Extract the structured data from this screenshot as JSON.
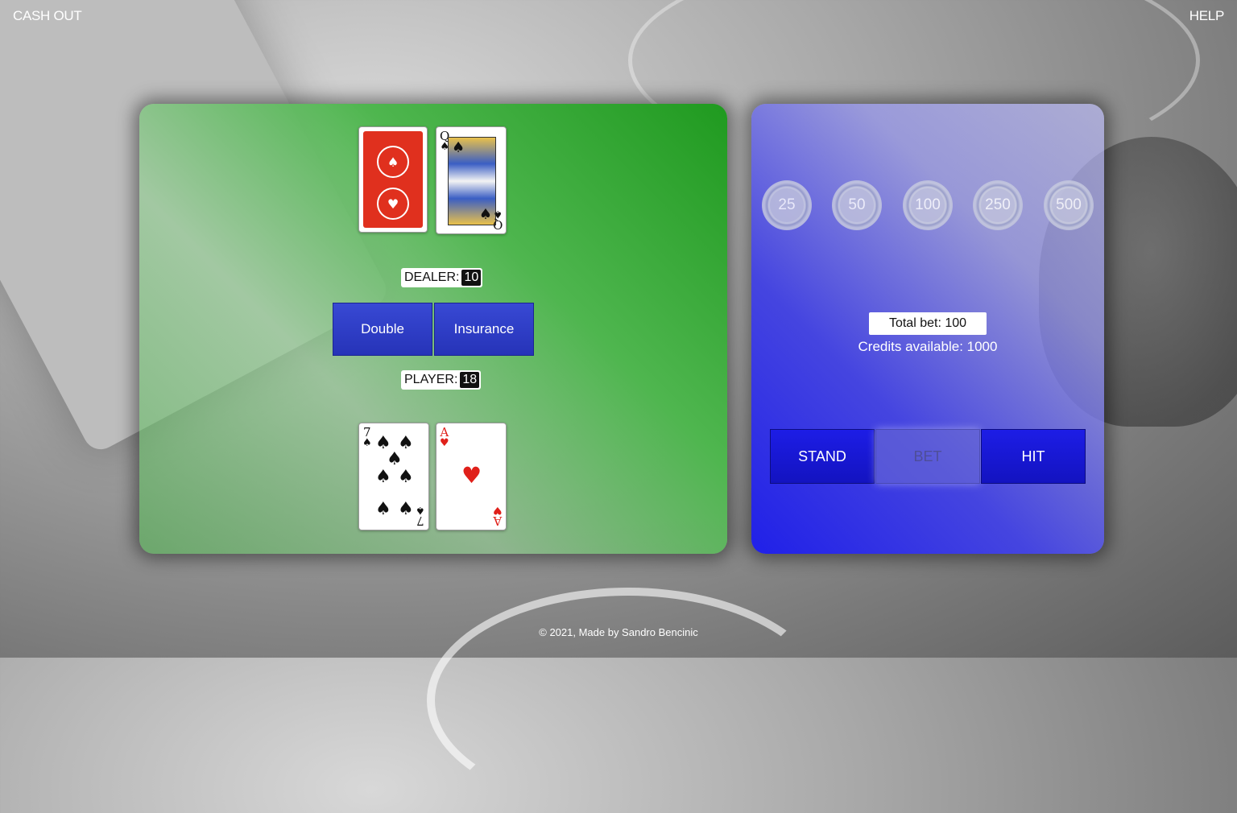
{
  "nav": {
    "cash_out": "CASH OUT",
    "help": "HELP"
  },
  "dealer": {
    "label": "DEALER:",
    "score": "10",
    "cards": [
      {
        "face_down": true
      },
      {
        "rank": "Q",
        "suit": "♠",
        "color": "black"
      }
    ]
  },
  "player": {
    "label": "PLAYER:",
    "score": "18",
    "cards": [
      {
        "rank": "7",
        "suit": "♠",
        "color": "black"
      },
      {
        "rank": "A",
        "suit": "♥",
        "color": "red"
      }
    ]
  },
  "options": {
    "double": "Double",
    "insurance": "Insurance"
  },
  "chips": [
    "25",
    "50",
    "100",
    "250",
    "500"
  ],
  "betting": {
    "total_bet": "Total bet: 100",
    "credits": "Credits available: 1000"
  },
  "actions": {
    "stand": "STAND",
    "bet": "BET",
    "hit": "HIT"
  },
  "footer": "© 2021, Made by Sandro Bencinic",
  "colors": {
    "table": "#1f9a1f",
    "control": "#2020e8",
    "button": "#2633b8"
  }
}
